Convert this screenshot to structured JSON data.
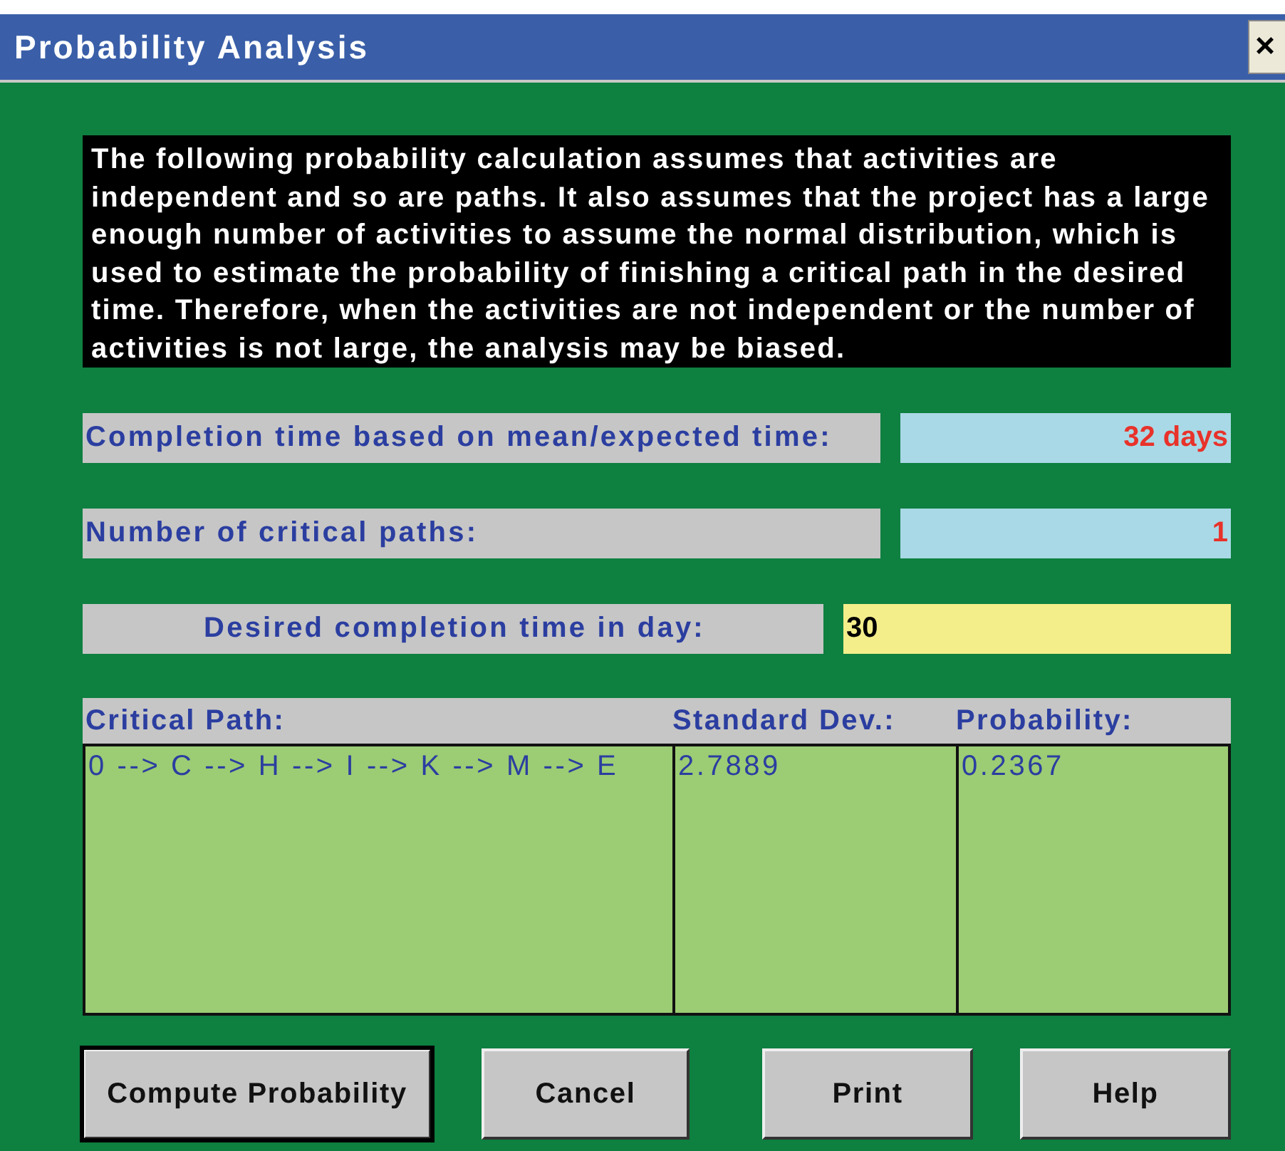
{
  "window": {
    "title": "Probability Analysis",
    "close": "×"
  },
  "description": "The following probability calculation assumes that activities are independent and so are paths. It also assumes that the project has a large enough number of activities to assume the normal distribution, which is used to estimate the probability of finishing a critical path in the desired time.  Therefore, when the activities are not independent or the number of activities is not large, the analysis may be biased.",
  "fields": [
    {
      "label": "Completion time based on mean/expected time:",
      "value": "32 days",
      "kind": "result"
    },
    {
      "label": "Number of critical paths:",
      "value": "1",
      "kind": "result"
    },
    {
      "label": "Desired completion time in day:",
      "value": "30",
      "kind": "input"
    }
  ],
  "table": {
    "columns": [
      "Critical Path:",
      "Standard Dev.:",
      "Probability:"
    ],
    "rows": [
      [
        "0 --> C --> H --> I --> K --> M --> E",
        "2.7889",
        "0.2367"
      ]
    ]
  },
  "buttons": [
    {
      "label": "Compute Probability",
      "focused": true
    },
    {
      "label": "Cancel",
      "focused": false
    },
    {
      "label": "Print",
      "focused": false
    },
    {
      "label": "Help",
      "focused": false
    }
  ]
}
